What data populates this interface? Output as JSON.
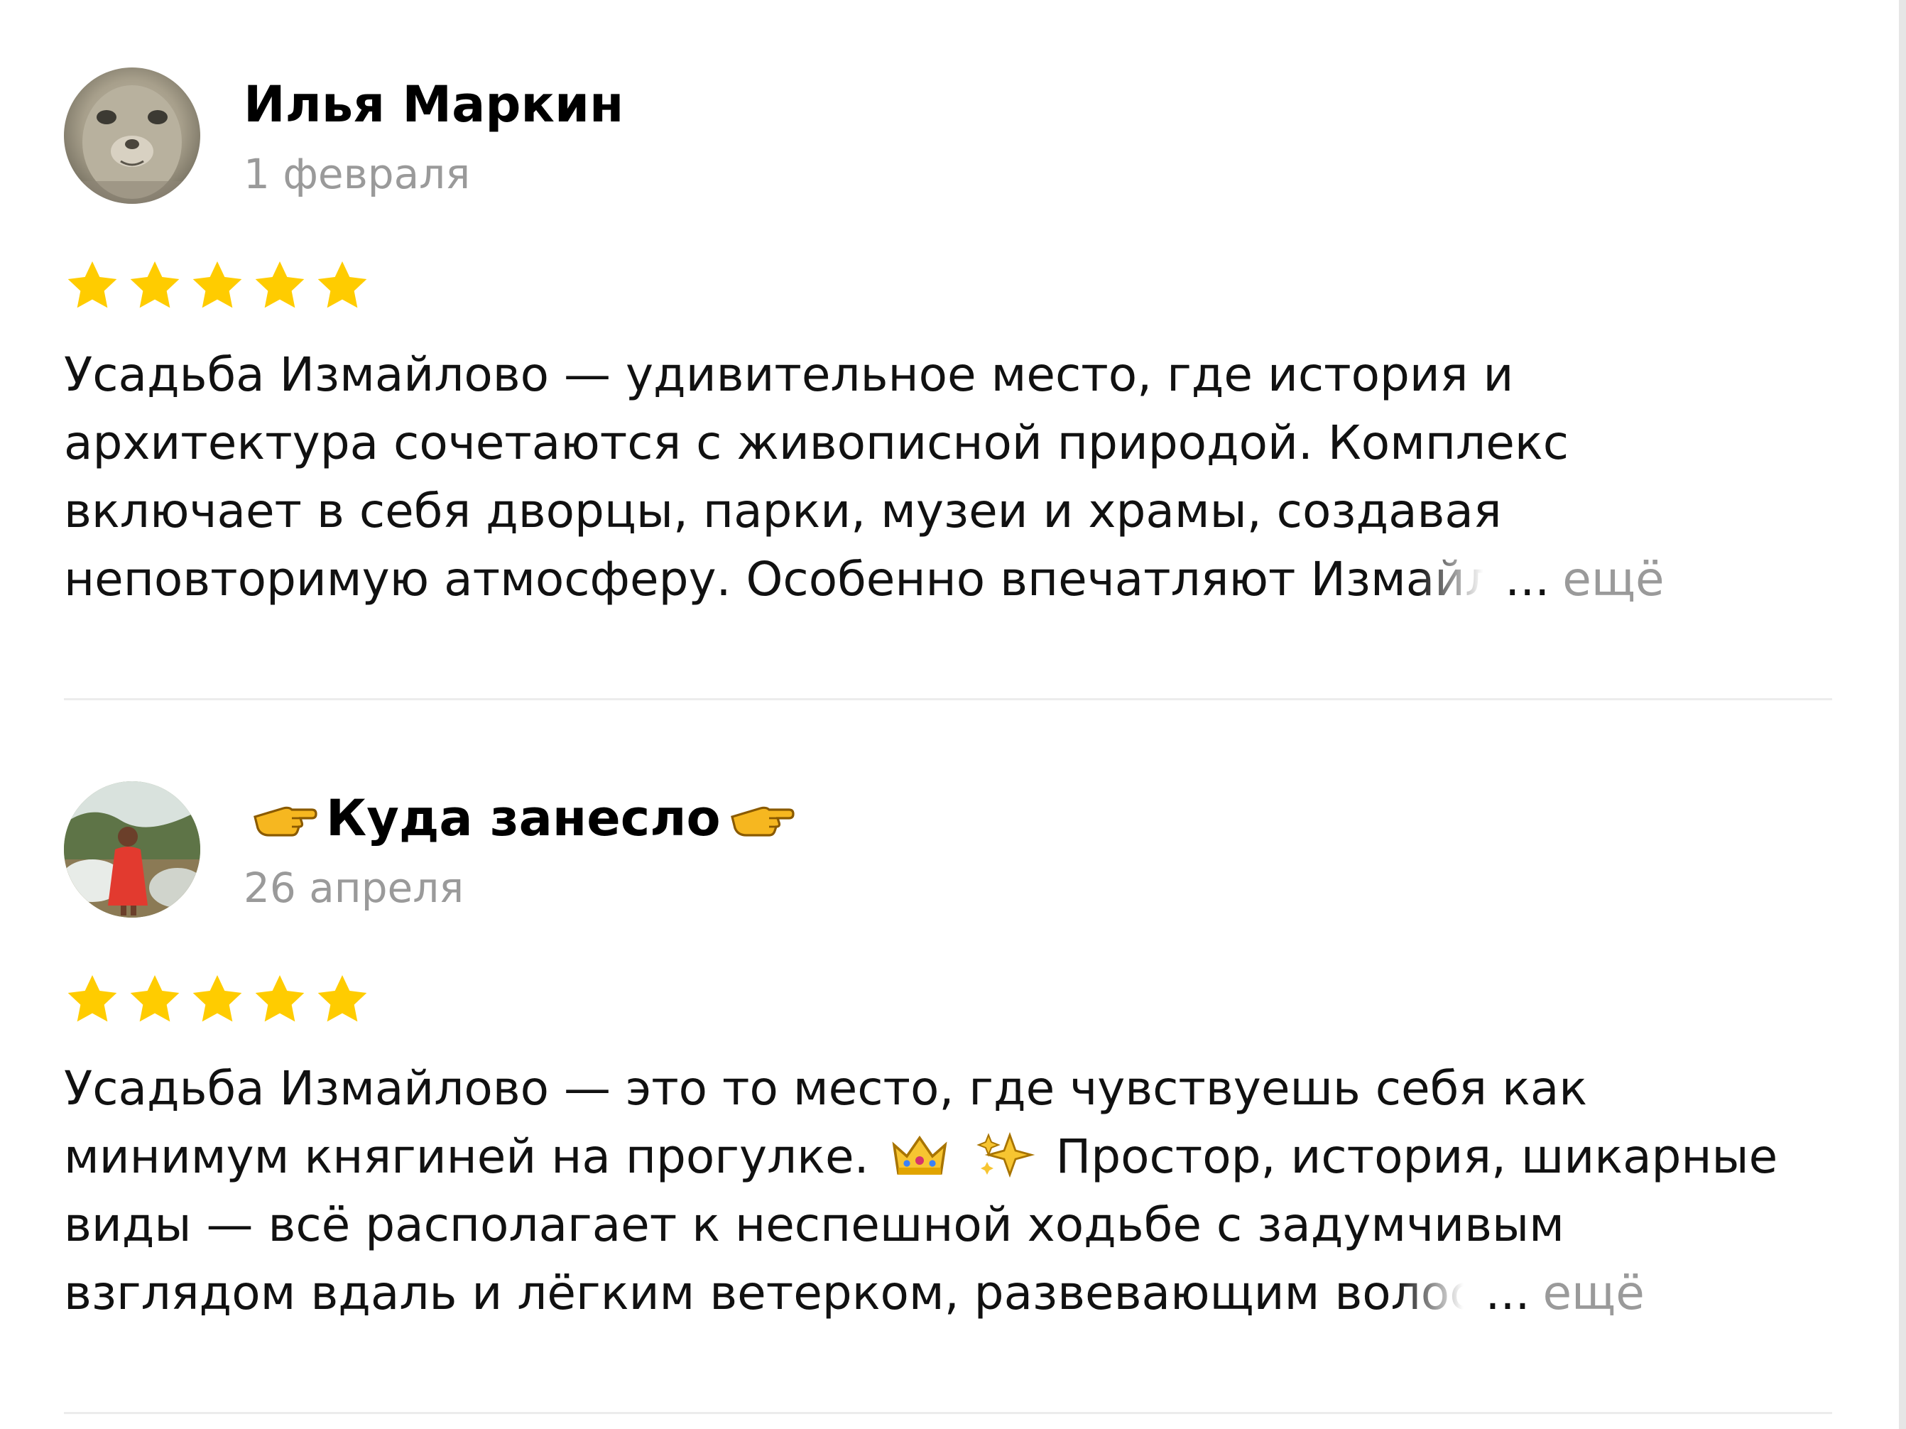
{
  "reviews": [
    {
      "author": "Илья Маркин",
      "author_prefix_icon": "",
      "author_suffix_icon": "",
      "date": "1 февраля",
      "rating": 5,
      "rating_max": 5,
      "text_lines": [
        "Усадьба Измайлово — удивительное место, где история и",
        "архитектура сочетаются с живописной природой. Комплекс",
        "включает в себя дворцы, парки, музеи и храмы, создавая",
        "неповторимую атмосферу. Особенно впечатляют Измайл"
      ],
      "ellipsis": "...",
      "more_label": "ещё"
    },
    {
      "author": "Куда занесло",
      "author_prefix_icon": "pointing-hand-icon",
      "author_suffix_icon": "pointing-hand-icon",
      "date": "26 апреля",
      "rating": 5,
      "rating_max": 5,
      "text_lines": [
        "Усадьба Измайлово — это то место, где чувствуешь себя как",
        "минимум княгиней на прогулке.",
        "Простор, история, шикарные",
        "виды — всё располагает к неспешной ходьбе с задумчивым",
        "взглядом вдаль и лёгким ветерком, развевающим волос"
      ],
      "inline_icons": [
        "crown-icon",
        "sparkles-icon"
      ],
      "ellipsis": "...",
      "more_label": "ещё"
    }
  ],
  "colors": {
    "star": "#FFCC00",
    "date": "#9A9A9A",
    "more": "#9A9A9A",
    "divider": "#ECECEC"
  }
}
